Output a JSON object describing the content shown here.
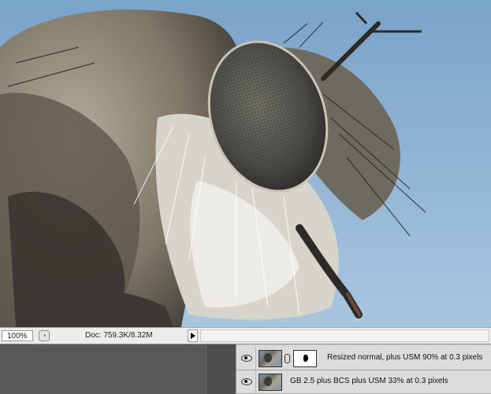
{
  "status_bar": {
    "zoom": "100%",
    "doc_info": "Doc: 759.3K/8.32M"
  },
  "layers": [
    {
      "name": "Resized normal, plus USM 90% at 0.3 pixels",
      "visible": true,
      "has_mask": true
    },
    {
      "name": "GB 2.5 plus BCS plus USM 33% at 0.3 pixels",
      "visible": true,
      "has_mask": false
    }
  ],
  "colors": {
    "sky": "#8fb4d4",
    "panel": "#535353",
    "layers_bg": "#d6d6d6",
    "status_bg": "#ececec"
  }
}
